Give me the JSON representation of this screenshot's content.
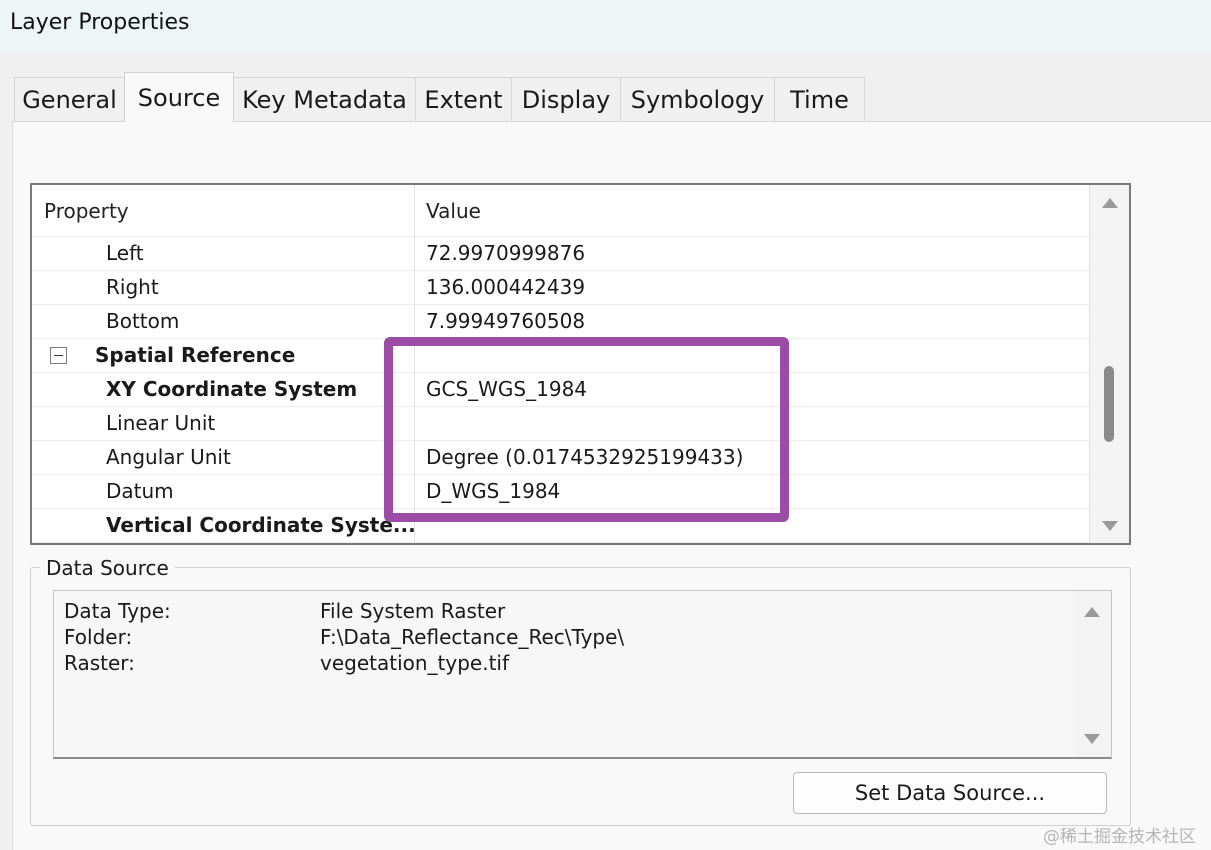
{
  "window": {
    "title": "Layer Properties"
  },
  "tabs": [
    {
      "label": "General"
    },
    {
      "label": "Source"
    },
    {
      "label": "Key Metadata"
    },
    {
      "label": "Extent"
    },
    {
      "label": "Display"
    },
    {
      "label": "Symbology"
    },
    {
      "label": "Time"
    }
  ],
  "active_tab": "Source",
  "property_grid": {
    "column_property": "Property",
    "column_value": "Value",
    "rows": [
      {
        "name": "Left",
        "value": "72.9970999876"
      },
      {
        "name": "Right",
        "value": "136.000442439"
      },
      {
        "name": "Bottom",
        "value": "7.99949760508"
      },
      {
        "name": "Spatial Reference",
        "value": "",
        "expanded": true
      },
      {
        "name": "XY Coordinate System",
        "value": "GCS_WGS_1984"
      },
      {
        "name": "Linear Unit",
        "value": ""
      },
      {
        "name": "Angular Unit",
        "value": "Degree (0.0174532925199433)"
      },
      {
        "name": "Datum",
        "value": "D_WGS_1984"
      },
      {
        "name": "Vertical Coordinate Syste...",
        "value": ""
      }
    ]
  },
  "data_source": {
    "group_label": "Data Source",
    "fields": [
      {
        "label": "Data Type:",
        "value": "File System Raster"
      },
      {
        "label": "Folder:",
        "value": "F:\\Data_Reflectance_Rec\\Type\\"
      },
      {
        "label": "Raster:",
        "value": "vegetation_type.tif"
      }
    ],
    "set_button_label": "Set Data Source..."
  },
  "highlight_color": "#9b4da6",
  "watermark": "@稀土掘金技术社区"
}
